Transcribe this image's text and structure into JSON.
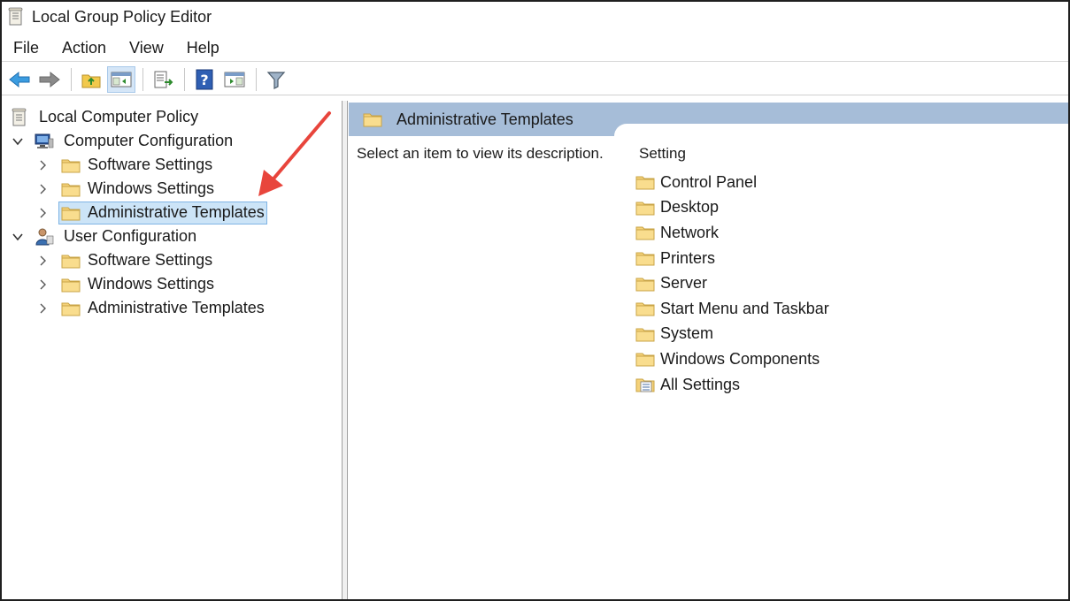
{
  "window": {
    "title": "Local Group Policy Editor"
  },
  "menu": [
    "File",
    "Action",
    "View",
    "Help"
  ],
  "toolbar": {
    "buttons": [
      "back-icon",
      "forward-icon",
      "up-folder-icon",
      "show-hide-console-tree-icon",
      "export-list-icon",
      "help-icon",
      "show-hide-action-pane-icon",
      "filter-icon"
    ]
  },
  "tree": {
    "root": "Local Computer Policy",
    "computer_config": "Computer Configuration",
    "user_config": "User Configuration",
    "computer_children": [
      "Software Settings",
      "Windows Settings",
      "Administrative Templates"
    ],
    "user_children": [
      "Software Settings",
      "Windows Settings",
      "Administrative Templates"
    ]
  },
  "right": {
    "header": "Administrative Templates",
    "description": "Select an item to view its description.",
    "column": "Setting",
    "items": [
      "Control Panel",
      "Desktop",
      "Network",
      "Printers",
      "Server",
      "Start Menu and Taskbar",
      "System",
      "Windows Components",
      "All Settings"
    ]
  },
  "colors": {
    "header_band": "#a6bdd8",
    "selection": "#cce4f7",
    "annotation_arrow": "#e8453c",
    "folder": "#f5d27a"
  }
}
